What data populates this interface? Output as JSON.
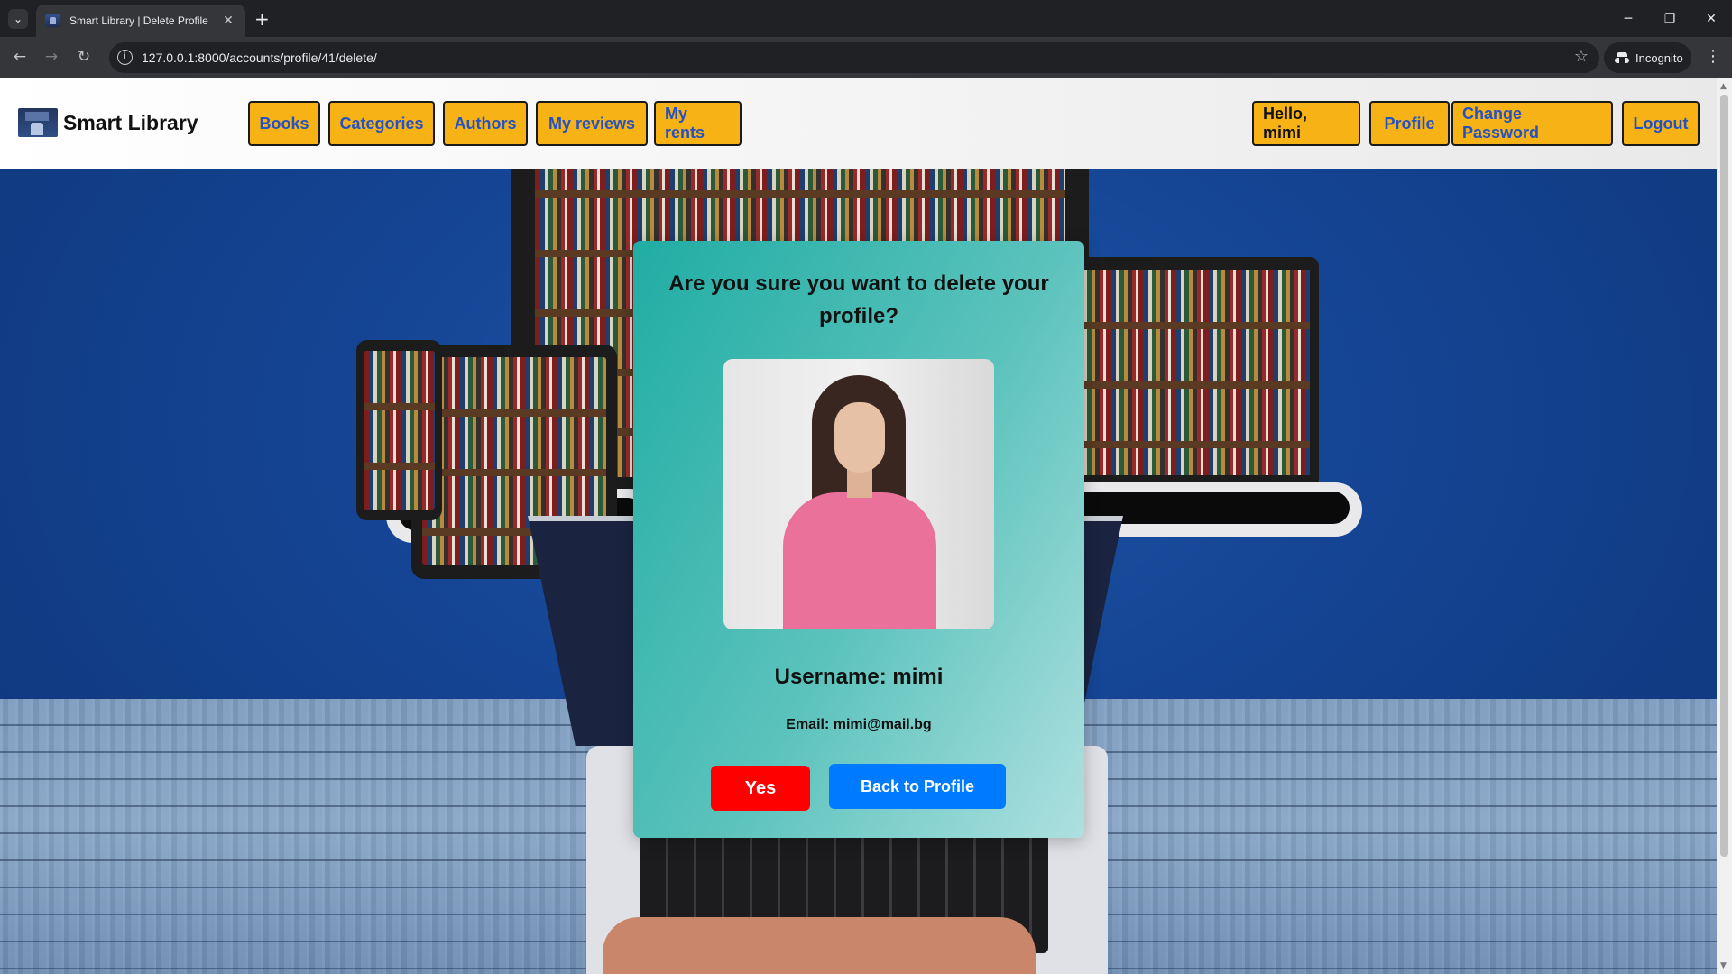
{
  "browser": {
    "tab_title": "Smart Library | Delete Profile",
    "url": "127.0.0.1:8000/accounts/profile/41/delete/",
    "incognito_label": "Incognito",
    "icons": [
      "tab-search-icon",
      "favicon-icon",
      "close-icon",
      "plus-icon",
      "minimize-icon",
      "restore-icon",
      "window-close-icon",
      "back-arrow-icon",
      "forward-arrow-icon",
      "reload-icon",
      "site-info-icon",
      "bookmark-star-icon",
      "incognito-icon",
      "kebab-menu-icon"
    ]
  },
  "navbar": {
    "brand": "Smart Library",
    "left_links": [
      {
        "label": "Books"
      },
      {
        "label": "Categories"
      },
      {
        "label": "Authors"
      },
      {
        "label": "My reviews"
      },
      {
        "label": "My rents"
      }
    ],
    "greeting": "Hello, mimi",
    "right_links": [
      {
        "label": "Profile"
      },
      {
        "label": "Change Password"
      },
      {
        "label": "Logout"
      }
    ],
    "colors": {
      "pill_bg": "#f7b315",
      "pill_text": "#2451c4"
    }
  },
  "confirm": {
    "title": "Are you sure you want to delete your profile?",
    "username": "Username: mimi",
    "email": "Email: mimi@mail.bg",
    "yes_label": "Yes",
    "back_label": "Back to Profile",
    "colors": {
      "yes": "#ff0000",
      "back": "#007bff",
      "card_start": "#20ada4",
      "card_end": "#aee0e0"
    }
  }
}
